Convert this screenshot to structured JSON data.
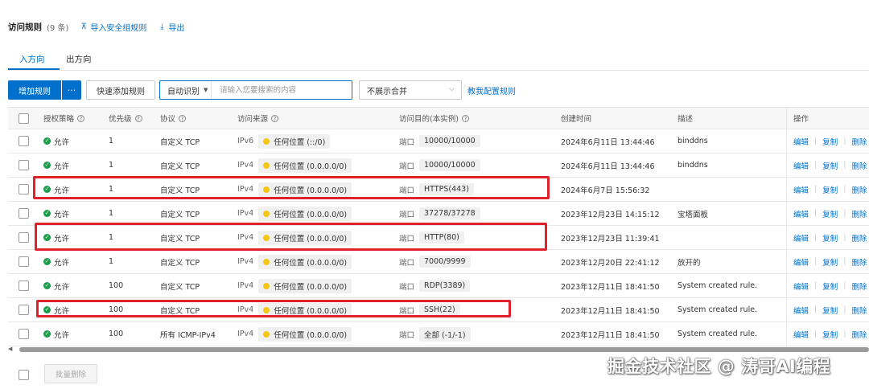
{
  "header": {
    "title": "访问规则",
    "count": "(9 条)",
    "import_label": "导入安全组规则",
    "export_label": "导出"
  },
  "tabs": [
    {
      "label": "入方向",
      "active": true
    },
    {
      "label": "出方向",
      "active": false
    }
  ],
  "toolbar": {
    "add_rule": "增加规则",
    "more": "···",
    "quick_add": "快速添加规则",
    "search_mode": "自动识别",
    "search_placeholder": "请输入您要搜索的内容",
    "merge_select": "不展示合并",
    "teach_link": "教我配置规则"
  },
  "table": {
    "columns": [
      "授权策略",
      "优先级",
      "协议",
      "访问来源",
      "访问目的(本实例)",
      "创建时间",
      "描述",
      "操作"
    ],
    "rows": [
      {
        "policy": "允许",
        "priority": "1",
        "protocol": "自定义 TCP",
        "ipver": "IPv6",
        "source": "任何位置 (::/0)",
        "port_label": "端口",
        "port": "10000/10000",
        "created": "2024年6月11日 13:44:46",
        "desc": "binddns"
      },
      {
        "policy": "允许",
        "priority": "1",
        "protocol": "自定义 TCP",
        "ipver": "IPv4",
        "source": "任何位置 (0.0.0.0/0)",
        "port_label": "端口",
        "port": "10000/10000",
        "created": "2024年6月11日 13:44:46",
        "desc": "binddns"
      },
      {
        "policy": "允许",
        "priority": "1",
        "protocol": "自定义 TCP",
        "ipver": "IPv4",
        "source": "任何位置 (0.0.0.0/0)",
        "port_label": "端口",
        "port": "HTTPS(443)",
        "created": "2024年6月7日 15:56:32",
        "desc": ""
      },
      {
        "policy": "允许",
        "priority": "1",
        "protocol": "自定义 TCP",
        "ipver": "IPv4",
        "source": "任何位置 (0.0.0.0/0)",
        "port_label": "端口",
        "port": "37278/37278",
        "created": "2023年12月23日 14:15:12",
        "desc": "宝塔面板"
      },
      {
        "policy": "允许",
        "priority": "1",
        "protocol": "自定义 TCP",
        "ipver": "IPv4",
        "source": "任何位置 (0.0.0.0/0)",
        "port_label": "端口",
        "port": "HTTP(80)",
        "created": "2023年12月23日 11:39:41",
        "desc": ""
      },
      {
        "policy": "允许",
        "priority": "1",
        "protocol": "自定义 TCP",
        "ipver": "IPv4",
        "source": "任何位置 (0.0.0.0/0)",
        "port_label": "端口",
        "port": "7000/9999",
        "created": "2023年12月20日 22:41:12",
        "desc": "放开的"
      },
      {
        "policy": "允许",
        "priority": "100",
        "protocol": "自定义 TCP",
        "ipver": "IPv4",
        "source": "任何位置 (0.0.0.0/0)",
        "port_label": "端口",
        "port": "RDP(3389)",
        "created": "2023年12月11日 18:41:50",
        "desc": "System created rule."
      },
      {
        "policy": "允许",
        "priority": "100",
        "protocol": "自定义 TCP",
        "ipver": "IPv4",
        "source": "任何位置 (0.0.0.0/0)",
        "port_label": "端口",
        "port": "SSH(22)",
        "created": "2023年12月11日 18:41:50",
        "desc": "System created rule."
      },
      {
        "policy": "允许",
        "priority": "100",
        "protocol": "所有 ICMP-IPv4",
        "ipver": "IPv4",
        "source": "任何位置 (0.0.0.0/0)",
        "port_label": "端口",
        "port": "全部 (-1/-1)",
        "created": "2023年12月11日 18:41:50",
        "desc": "System created rule."
      }
    ],
    "actions": [
      "编辑",
      "复制",
      "删除"
    ]
  },
  "footer": {
    "batch_delete": "批量删除"
  },
  "watermark": "掘金技术社区 @ 涛哥AI编程",
  "colors": {
    "accent": "#0070cc",
    "allow": "#1a9c4a",
    "source_dot": "#f5c518",
    "highlight": "#e0202a"
  }
}
